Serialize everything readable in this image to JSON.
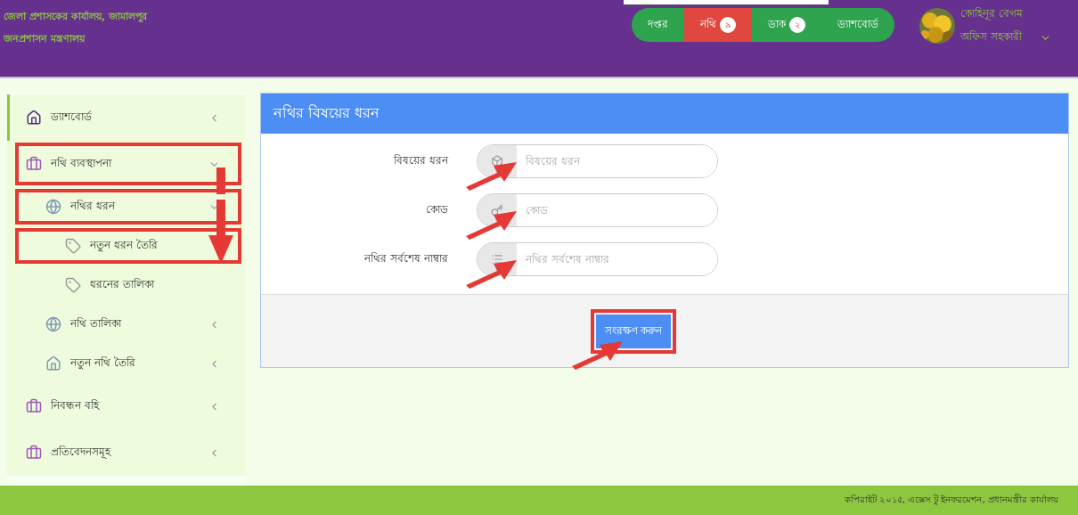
{
  "header": {
    "title_lines": [
      "জেলা প্রশাসকের কার্যালয়, জামালপুর",
      "জনপ্রশাসন মন্ত্রণালয়"
    ],
    "nav": [
      {
        "label": "দপ্তর",
        "selected": false
      },
      {
        "label": "নথি",
        "badge": "৯",
        "selected": true
      },
      {
        "label": "ডাক",
        "badge": "২",
        "selected": false
      },
      {
        "label": "ড্যাশবোর্ড",
        "selected": false
      }
    ],
    "user": {
      "name": "কোহিনূর বেগম",
      "role": "অফিস সহকারী"
    }
  },
  "sidebar": {
    "items": [
      {
        "label": "ড্যাশবোর্ড",
        "kind": "home",
        "selected": true,
        "expanded": false,
        "annotated": false
      },
      {
        "label": "নথি ব্যবস্থাপনা",
        "kind": "briefcase",
        "selected": false,
        "expanded": true,
        "annotated": true,
        "children": [
          {
            "label": "নথির ধরন",
            "kind": "globe",
            "selected": false,
            "expanded": true,
            "annotated": true,
            "children": [
              {
                "label": "নতুন ধরন তৈরি",
                "kind": "tag",
                "selected": false,
                "annotated": true
              },
              {
                "label": "ধরনের তালিকা",
                "kind": "tag",
                "selected": false,
                "annotated": false
              }
            ]
          },
          {
            "label": "নথি তালিকা",
            "kind": "globe",
            "selected": false,
            "expanded": false,
            "annotated": false
          },
          {
            "label": "নতুন নথি তৈরি",
            "kind": "home",
            "selected": false,
            "expanded": false,
            "annotated": false
          }
        ]
      },
      {
        "label": "নিবন্ধন বহি",
        "kind": "briefcase",
        "selected": false,
        "expanded": false,
        "annotated": false
      },
      {
        "label": "প্রতিবেদনসমূহ",
        "kind": "briefcase",
        "selected": false,
        "expanded": false,
        "annotated": false
      }
    ]
  },
  "panel": {
    "title": "নথির বিষয়ের ধরন",
    "fields": [
      {
        "label": "বিষয়ের ধরন",
        "kind": "cube",
        "placeholder": "বিষয়ের ধরন",
        "annotated": true
      },
      {
        "label": "কোড",
        "kind": "key",
        "placeholder": "কোড",
        "annotated": true
      },
      {
        "label": "নথির সর্বশেষ নাম্বার",
        "kind": "list",
        "placeholder": "নথির সর্বশেষ নাম্বার",
        "annotated": true
      }
    ],
    "save_button": {
      "label": "সংরক্ষণ করুন",
      "annotated": true
    }
  },
  "footer": {
    "text": "কপিরাইট ২০১৫, এক্সেস টু ইনফরমেশন, প্রধানমন্ত্রীর কার্যালয়"
  }
}
